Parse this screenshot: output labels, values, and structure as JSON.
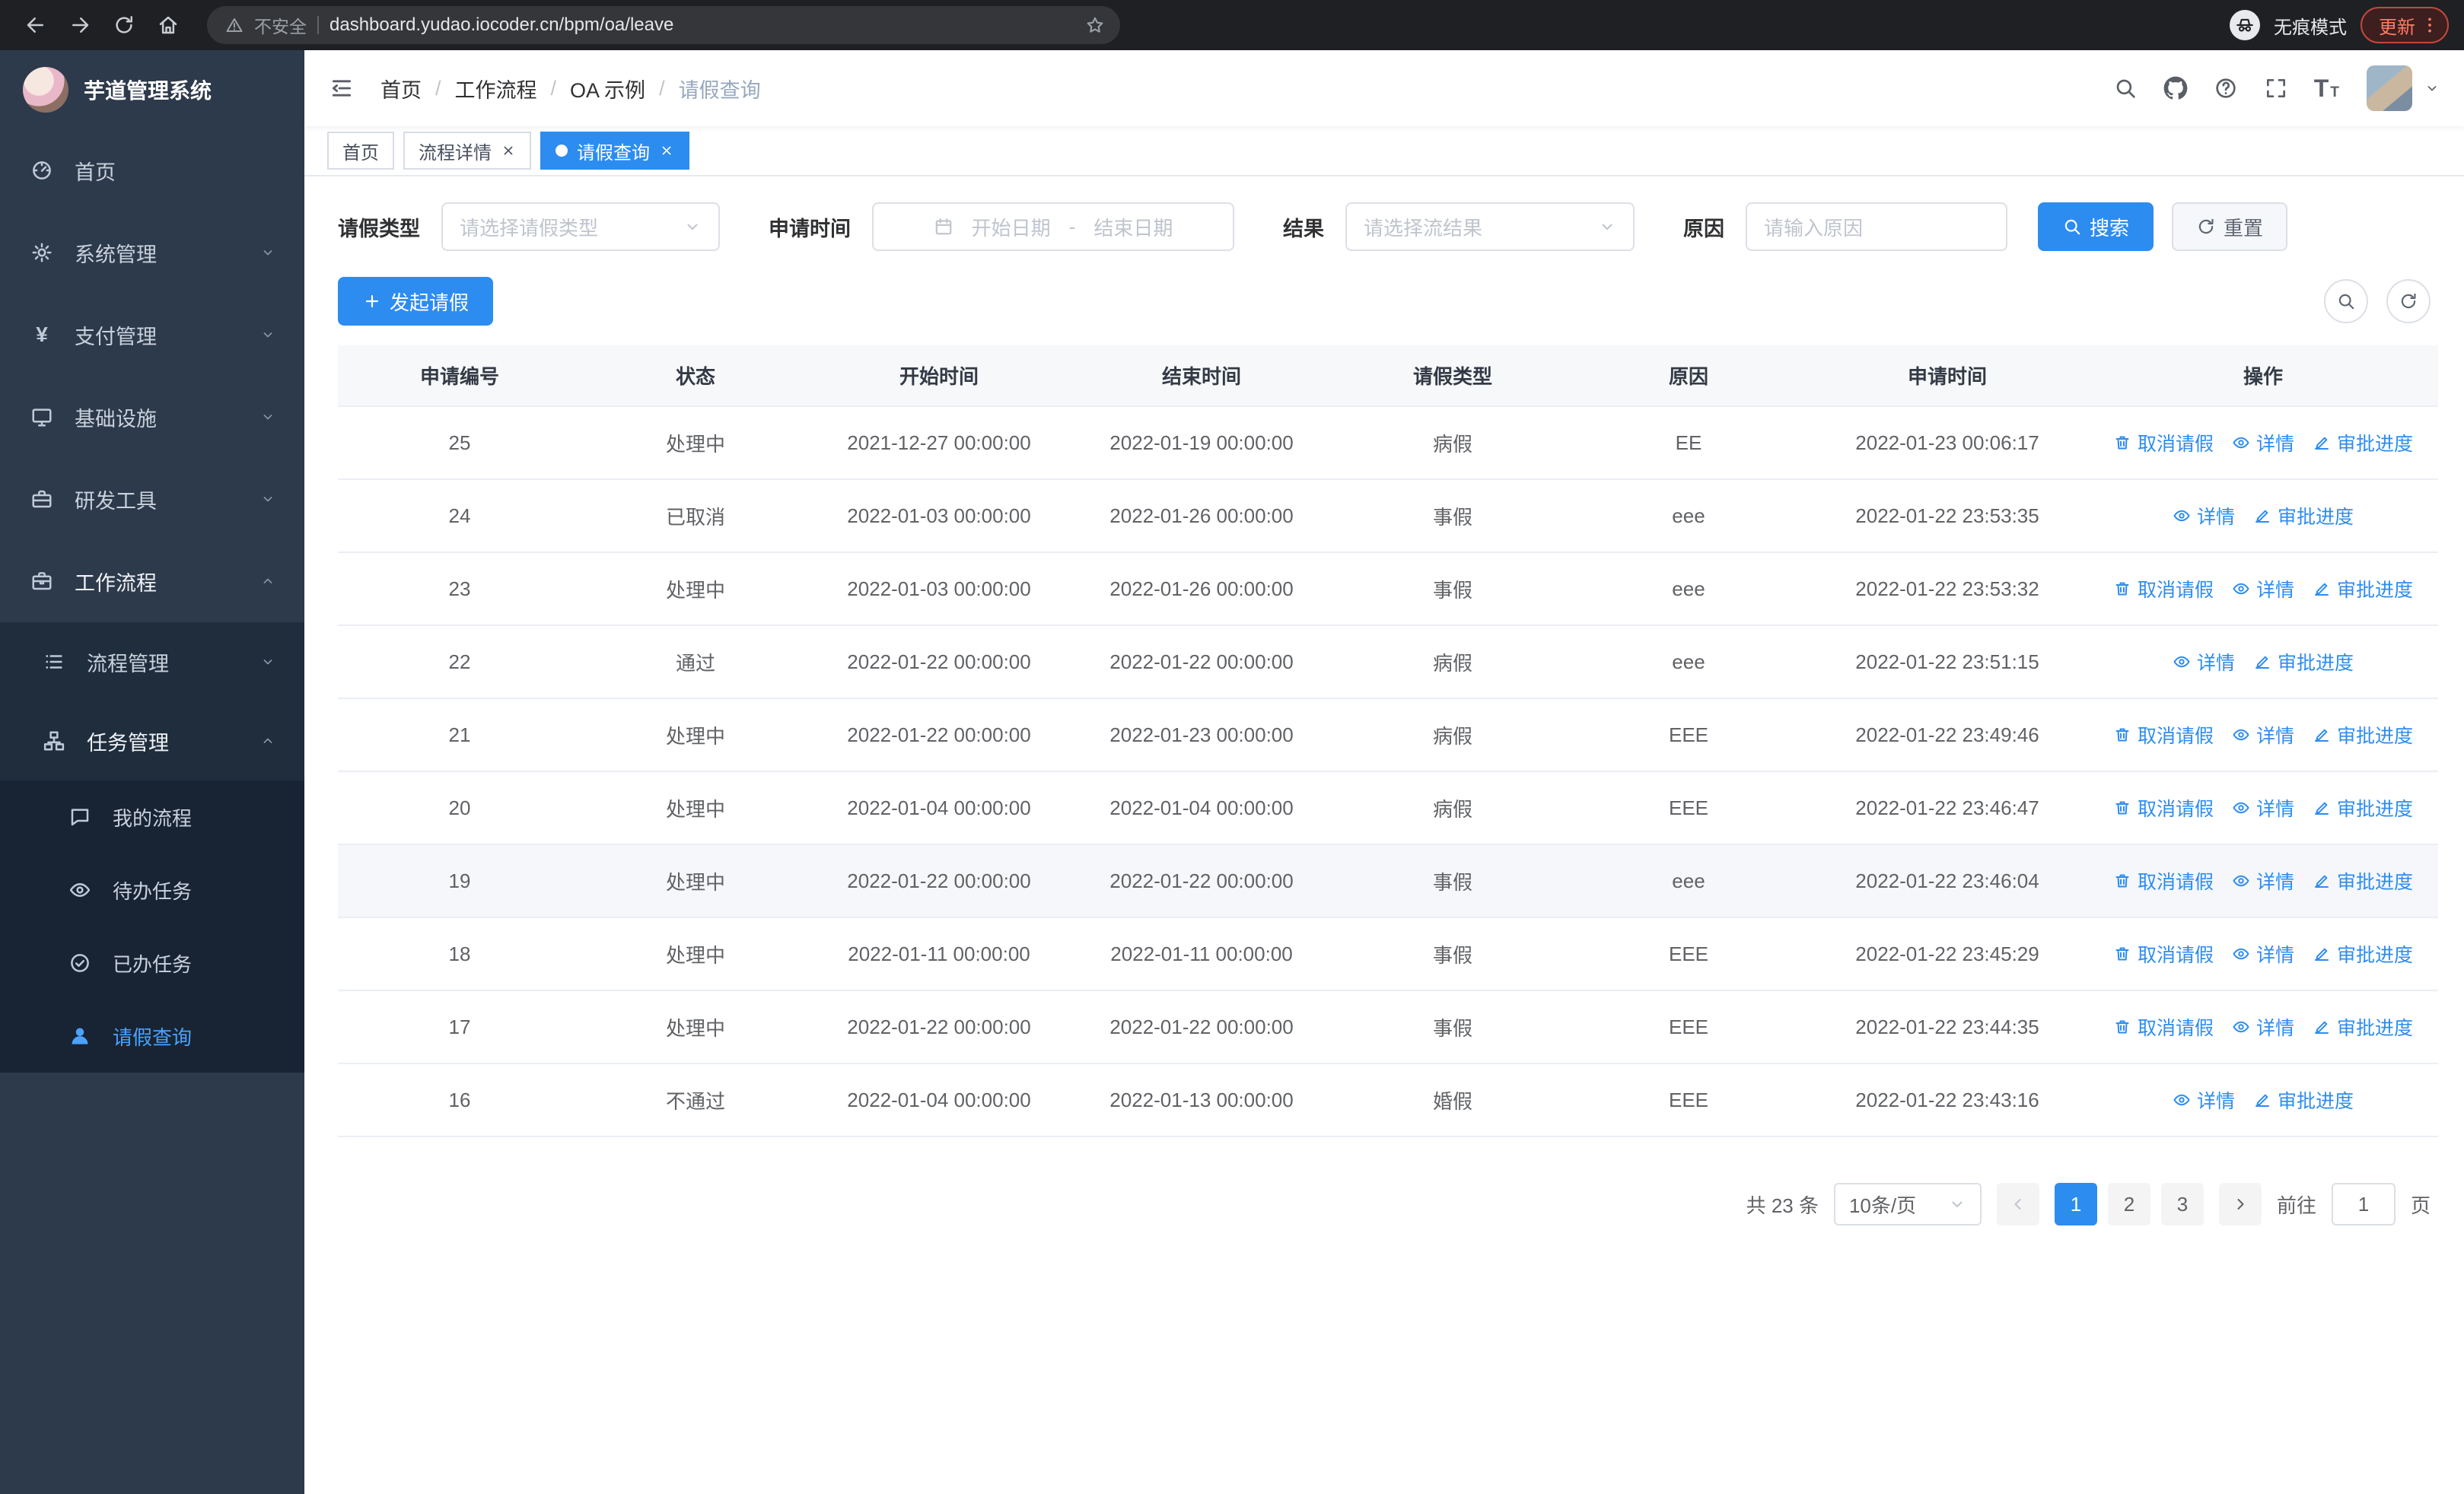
{
  "colors": {
    "accent": "#2d8cf0",
    "chrome-bg": "#1e2023",
    "sidebar-bg": "#2d3a4b",
    "sidebar-sub-bg": "#1f2d3d",
    "sidebar-deep-bg": "#182434",
    "active-text": "#4aa3ff"
  },
  "browser": {
    "security_label": "不安全",
    "url": "dashboard.yudao.iocoder.cn/bpm/oa/leave",
    "incognito_label": "无痕模式",
    "update_label": "更新"
  },
  "sidebar": {
    "logo_title": "芋道管理系统",
    "menu": [
      {
        "key": "home",
        "label": "首页",
        "icon": "dashboard-icon",
        "chevron": null
      },
      {
        "key": "system",
        "label": "系统管理",
        "icon": "gear-icon",
        "chevron": "down"
      },
      {
        "key": "payment",
        "label": "支付管理",
        "icon": "yen-icon",
        "chevron": "down"
      },
      {
        "key": "infrastructure",
        "label": "基础设施",
        "icon": "monitor-icon",
        "chevron": "down"
      },
      {
        "key": "devtools",
        "label": "研发工具",
        "icon": "toolbox-icon",
        "chevron": "down"
      },
      {
        "key": "workflow",
        "label": "工作流程",
        "icon": "briefcase-icon",
        "chevron": "up",
        "open": true
      }
    ],
    "submenu": [
      {
        "key": "process-management",
        "label": "流程管理",
        "icon": "list-icon",
        "chevron": "down"
      },
      {
        "key": "task-management",
        "label": "任务管理",
        "icon": "tasks-icon",
        "chevron": "up",
        "open": true
      }
    ],
    "subitems": [
      {
        "key": "my-process",
        "label": "我的流程",
        "icon": "chat-icon",
        "active": false
      },
      {
        "key": "todo-tasks",
        "label": "待办任务",
        "icon": "eye-icon",
        "active": false
      },
      {
        "key": "done-tasks",
        "label": "已办任务",
        "icon": "done-icon",
        "active": false
      },
      {
        "key": "leave-query",
        "label": "请假查询",
        "icon": "user-icon",
        "active": true
      }
    ]
  },
  "header": {
    "breadcrumb": [
      "首页",
      "工作流程",
      "OA 示例",
      "请假查询"
    ]
  },
  "tabs": [
    {
      "key": "home",
      "label": "首页",
      "closable": false,
      "active": false
    },
    {
      "key": "process-detail",
      "label": "流程详情",
      "closable": true,
      "active": false
    },
    {
      "key": "leave-query",
      "label": "请假查询",
      "closable": true,
      "active": true
    }
  ],
  "filters": {
    "type_label": "请假类型",
    "type_placeholder": "请选择请假类型",
    "time_label": "申请时间",
    "start_placeholder": "开始日期",
    "range_separator": "-",
    "end_placeholder": "结束日期",
    "result_label": "结果",
    "result_placeholder": "请选择流结果",
    "reason_label": "原因",
    "reason_placeholder": "请输入原因",
    "search_label": "搜索",
    "reset_label": "重置"
  },
  "toolbar": {
    "create_label": "发起请假"
  },
  "table": {
    "columns": [
      "申请编号",
      "状态",
      "开始时间",
      "结束时间",
      "请假类型",
      "原因",
      "申请时间",
      "操作"
    ],
    "action_cancel": "取消请假",
    "action_detail": "详情",
    "action_progress": "审批进度",
    "rows": [
      {
        "id": "25",
        "status": "处理中",
        "start": "2021-12-27 00:00:00",
        "end": "2022-01-19 00:00:00",
        "type": "病假",
        "reason": "EE",
        "applied": "2022-01-23 00:06:17",
        "cancelable": true,
        "highlight": false
      },
      {
        "id": "24",
        "status": "已取消",
        "start": "2022-01-03 00:00:00",
        "end": "2022-01-26 00:00:00",
        "type": "事假",
        "reason": "eee",
        "applied": "2022-01-22 23:53:35",
        "cancelable": false,
        "highlight": false
      },
      {
        "id": "23",
        "status": "处理中",
        "start": "2022-01-03 00:00:00",
        "end": "2022-01-26 00:00:00",
        "type": "事假",
        "reason": "eee",
        "applied": "2022-01-22 23:53:32",
        "cancelable": true,
        "highlight": false
      },
      {
        "id": "22",
        "status": "通过",
        "start": "2022-01-22 00:00:00",
        "end": "2022-01-22 00:00:00",
        "type": "病假",
        "reason": "eee",
        "applied": "2022-01-22 23:51:15",
        "cancelable": false,
        "highlight": false
      },
      {
        "id": "21",
        "status": "处理中",
        "start": "2022-01-22 00:00:00",
        "end": "2022-01-23 00:00:00",
        "type": "病假",
        "reason": "EEE",
        "applied": "2022-01-22 23:49:46",
        "cancelable": true,
        "highlight": false
      },
      {
        "id": "20",
        "status": "处理中",
        "start": "2022-01-04 00:00:00",
        "end": "2022-01-04 00:00:00",
        "type": "病假",
        "reason": "EEE",
        "applied": "2022-01-22 23:46:47",
        "cancelable": true,
        "highlight": false
      },
      {
        "id": "19",
        "status": "处理中",
        "start": "2022-01-22 00:00:00",
        "end": "2022-01-22 00:00:00",
        "type": "事假",
        "reason": "eee",
        "applied": "2022-01-22 23:46:04",
        "cancelable": true,
        "highlight": true
      },
      {
        "id": "18",
        "status": "处理中",
        "start": "2022-01-11 00:00:00",
        "end": "2022-01-11 00:00:00",
        "type": "事假",
        "reason": "EEE",
        "applied": "2022-01-22 23:45:29",
        "cancelable": true,
        "highlight": false
      },
      {
        "id": "17",
        "status": "处理中",
        "start": "2022-01-22 00:00:00",
        "end": "2022-01-22 00:00:00",
        "type": "事假",
        "reason": "EEE",
        "applied": "2022-01-22 23:44:35",
        "cancelable": true,
        "highlight": false
      },
      {
        "id": "16",
        "status": "不通过",
        "start": "2022-01-04 00:00:00",
        "end": "2022-01-13 00:00:00",
        "type": "婚假",
        "reason": "EEE",
        "applied": "2022-01-22 23:43:16",
        "cancelable": false,
        "highlight": false
      }
    ]
  },
  "pagination": {
    "total_label": "共 23 条",
    "page_size": "10条/页",
    "pages": [
      "1",
      "2",
      "3"
    ],
    "active_page": "1",
    "goto_label": "前往",
    "goto_value": "1",
    "page_label": "页"
  }
}
